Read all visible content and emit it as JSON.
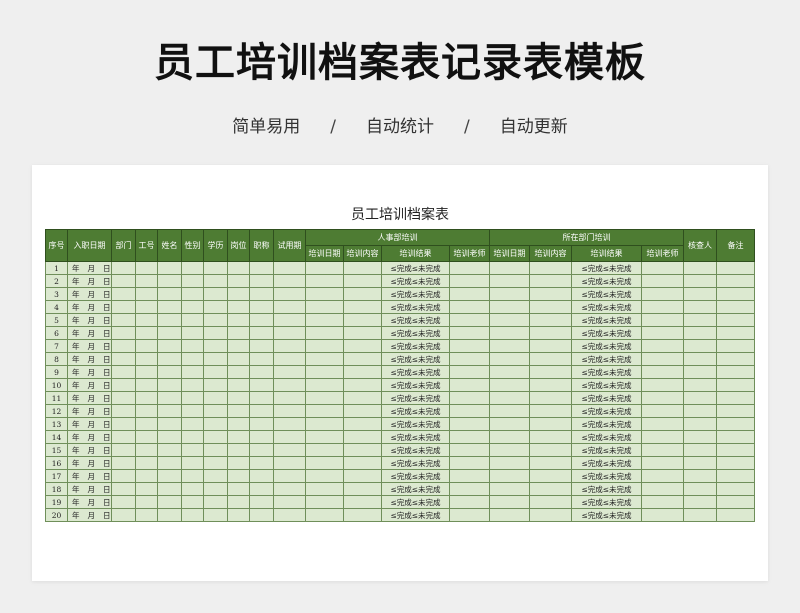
{
  "header": {
    "title": "员工培训档案表记录表模板",
    "features": [
      "简单易用",
      "自动统计",
      "自动更新"
    ],
    "separator": "/"
  },
  "sheet": {
    "title": "员工培训档案表",
    "columns": {
      "seq": "序号",
      "entry_date": "入职日期",
      "dept": "部门",
      "emp_no": "工号",
      "name": "姓名",
      "gender": "性别",
      "education": "学历",
      "position": "岗位",
      "title": "职称",
      "probation": "试用期",
      "hr_group": "人事部培训",
      "dept_group": "所在部门培训",
      "train_date": "培训日期",
      "train_content": "培训内容",
      "train_result": "培训结果",
      "trainer": "培训老师",
      "reviewer": "核查人",
      "remarks": "备注"
    },
    "date_parts": [
      "年",
      "月",
      "日"
    ],
    "result_text": "≤完成≤未完成",
    "rows": [
      1,
      2,
      3,
      4,
      5,
      6,
      7,
      8,
      9,
      10,
      11,
      12,
      13,
      14,
      15,
      16,
      17,
      18,
      19,
      20
    ]
  },
  "colors": {
    "header_green": "#4e7c33",
    "cell_green": "#dce9d0",
    "page_bg": "#efefef"
  }
}
